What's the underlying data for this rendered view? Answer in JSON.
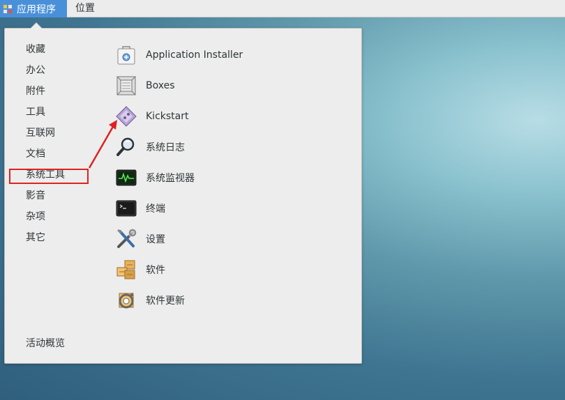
{
  "topbar": {
    "applications_label": "应用程序",
    "places_label": "位置"
  },
  "menu": {
    "categories": [
      {
        "label": "收藏"
      },
      {
        "label": "办公"
      },
      {
        "label": "附件"
      },
      {
        "label": "工具"
      },
      {
        "label": "互联网"
      },
      {
        "label": "文档"
      },
      {
        "label": "系统工具"
      },
      {
        "label": "影音"
      },
      {
        "label": "杂项"
      },
      {
        "label": "其它"
      }
    ],
    "apps": [
      {
        "label": "Application Installer",
        "icon": "application-installer-icon"
      },
      {
        "label": "Boxes",
        "icon": "boxes-icon"
      },
      {
        "label": "Kickstart",
        "icon": "kickstart-icon"
      },
      {
        "label": "系统日志",
        "icon": "system-log-icon"
      },
      {
        "label": "系统监视器",
        "icon": "system-monitor-icon"
      },
      {
        "label": "终端",
        "icon": "terminal-icon"
      },
      {
        "label": "设置",
        "icon": "settings-icon"
      },
      {
        "label": "软件",
        "icon": "software-icon"
      },
      {
        "label": "软件更新",
        "icon": "software-update-icon"
      }
    ],
    "activities_label": "活动概览"
  },
  "colors": {
    "accent": "#4a90d9",
    "annotation": "#e02020"
  }
}
